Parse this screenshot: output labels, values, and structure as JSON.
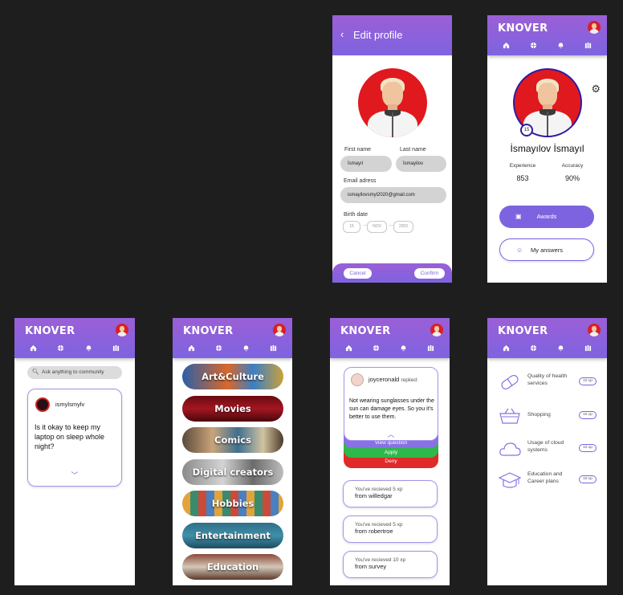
{
  "brand": "KNOVER",
  "edit_profile": {
    "title": "Edit profile",
    "first_name_label": "First name",
    "last_name_label": "Last name",
    "first_name": "İsmayıl",
    "last_name": "İsmayilov",
    "email_label": "Email adress",
    "email": "ismayilovsmyl2020@gmail.com",
    "birth_label": "Birth date",
    "birth_day": "15",
    "birth_month": "NOV",
    "birth_year": "2003",
    "cancel": "Cancel",
    "confirm": "Confirm"
  },
  "profile": {
    "level": "15",
    "name": "İsmayılov İsmayıl",
    "experience_label": "Experience",
    "experience": "853",
    "accuracy_label": "Accuracy",
    "accuracy": "90%",
    "awards": "Awards",
    "my_answers": "My answers"
  },
  "feed": {
    "search_placeholder": "Ask anything to community",
    "post_user": "ismylsmylv",
    "post_text": "Is it okay to keep my laptop on sleep whole night?"
  },
  "categories": [
    "Art&Culture",
    "Movies",
    "Comics",
    "Digital creators",
    "Hobbies",
    "Entertainment",
    "Education"
  ],
  "notifications": {
    "reply_user": "joyceronald",
    "reply_suffix": "replied:",
    "reply_text": "Not wearing sunglasses under the sun can damage eyes. So you it's better to use them.",
    "view_question": "View question",
    "apply": "Apply",
    "deny": "Deny",
    "xp_items": [
      {
        "line1": "You've recieved 5 xp",
        "line2": "from willedgar"
      },
      {
        "line1": "You've recieved 5 xp",
        "line2": "from robertroe"
      },
      {
        "line1": "You've recieved 10 xp",
        "line2": "from survey"
      }
    ]
  },
  "skills": [
    {
      "label": "Quality of health services",
      "xp": "10 xp",
      "icon": "pill-icon"
    },
    {
      "label": "Shopping",
      "xp": "10 xp",
      "icon": "basket-icon"
    },
    {
      "label": "Usage of cloud systems",
      "xp": "10 xp",
      "icon": "cloud-icon"
    },
    {
      "label": "Education and Career plans",
      "xp": "10 xp",
      "icon": "graduation-cap-icon"
    }
  ],
  "colors": {
    "accent": "#7e63e0",
    "header_top": "#9b5fd6",
    "apply": "#2fb84a",
    "deny": "#e02a2a",
    "avatar_bg": "#e0191f"
  }
}
